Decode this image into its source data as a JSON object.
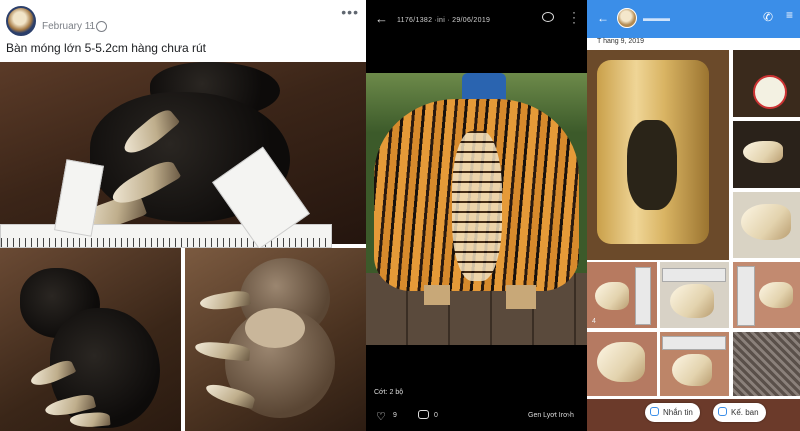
{
  "left_post": {
    "date": "February 11",
    "separator": "·",
    "more_icon": "more-horizontal-icon",
    "caption": "Bàn móng lớn 5-5.2cm hàng chưa rút"
  },
  "viewer": {
    "counter": "1176/1382 ·ini · 29/06/2019",
    "caption": "Cớt: 2 bộ",
    "likes": "9",
    "comments": "0",
    "share_label": "Gen Lyơt Irơ›h"
  },
  "chat": {
    "date_label": "T hang 9, 2019",
    "date_stamp": "4",
    "buttons": [
      {
        "label": "Nhắn tin",
        "icon": "message-icon"
      },
      {
        "label": "Kế. ban",
        "icon": "add-friend-icon"
      }
    ]
  },
  "colors": {
    "chat_header": "#3b8ee8",
    "viewer_bg": "#000000",
    "post_bg": "#ffffff"
  }
}
